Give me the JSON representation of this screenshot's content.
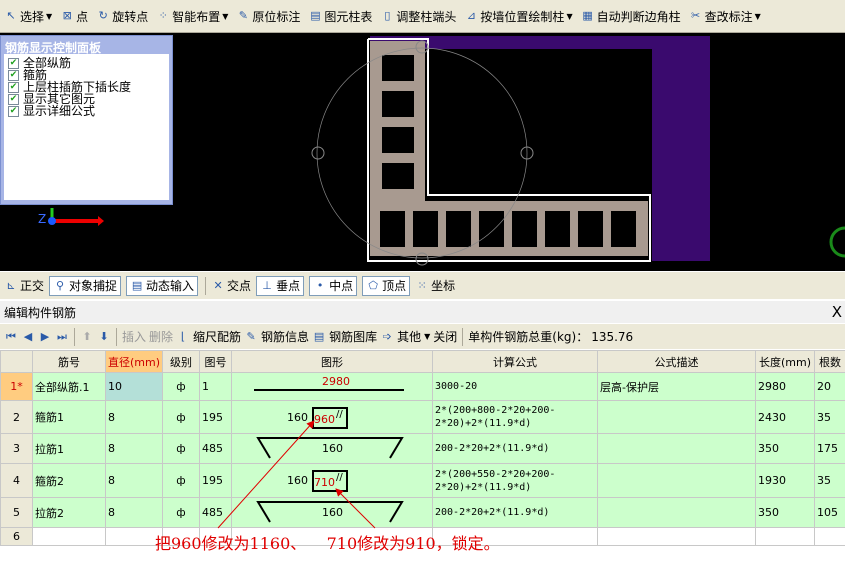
{
  "toolbar": {
    "items": [
      {
        "icon": "cursor-icon",
        "label": "选择",
        "dropdown": true
      },
      {
        "icon": "point-icon",
        "label": "点"
      },
      {
        "icon": "rotate-point-icon",
        "label": "旋转点"
      },
      {
        "icon": "smart-layout-icon",
        "label": "智能布置",
        "dropdown": true
      },
      {
        "icon": "annotate-icon",
        "label": "原位标注"
      },
      {
        "icon": "column-table-icon",
        "label": "图元柱表"
      },
      {
        "icon": "adjust-end-icon",
        "label": "调整柱端头"
      },
      {
        "icon": "wall-column-icon",
        "label": "按墙位置绘制柱",
        "dropdown": true
      },
      {
        "icon": "corner-column-icon",
        "label": "自动判断边角柱"
      },
      {
        "icon": "check-annotation-icon",
        "label": "查改标注",
        "dropdown": true
      }
    ]
  },
  "panel": {
    "title": "钢筋显示控制面板",
    "options": [
      {
        "label": "全部纵筋",
        "checked": true
      },
      {
        "label": "箍筋",
        "checked": true
      },
      {
        "label": "上层柱插筋下插长度",
        "checked": true
      },
      {
        "label": "显示其它图元",
        "checked": true
      },
      {
        "label": "显示详细公式",
        "checked": true
      }
    ],
    "axis_label": "Z"
  },
  "snap_toolbar": {
    "items": [
      "正交",
      "对象捕捉",
      "动态输入",
      "交点",
      "垂点",
      "中点",
      "顶点",
      "坐标"
    ]
  },
  "editor": {
    "title": "编辑构件钢筋",
    "close": "X",
    "toolbar": {
      "insert": "插入",
      "delete": "删除",
      "scale": "缩尺配筋",
      "info": "钢筋信息",
      "library": "钢筋图库",
      "other": "其他",
      "close": "关闭",
      "weight_label": "单构件钢筋总重(kg)：",
      "weight": "135.76"
    },
    "columns": [
      "",
      "筋号",
      "直径(mm)",
      "级别",
      "图号",
      "图形",
      "计算公式",
      "公式描述",
      "长度(mm)",
      "根数"
    ],
    "rows": [
      {
        "num": "1*",
        "name": "全部纵筋.1",
        "dia": "10",
        "grade": "ф",
        "fig": "1",
        "shape_label": "2980",
        "formula": "3000-20",
        "desc": "层高-保护层",
        "length": "2980",
        "count": "20"
      },
      {
        "num": "2",
        "name": "箍筋1",
        "dia": "8",
        "grade": "ф",
        "fig": "195",
        "shape_left": "160",
        "shape_label": "960",
        "formula": "2*(200+800-2*20+200-2*20)+2*(11.9*d)",
        "desc": "",
        "length": "2430",
        "count": "35"
      },
      {
        "num": "3",
        "name": "拉筋1",
        "dia": "8",
        "grade": "ф",
        "fig": "485",
        "shape_label": "160",
        "formula": "200-2*20+2*(11.9*d)",
        "desc": "",
        "length": "350",
        "count": "175"
      },
      {
        "num": "4",
        "name": "箍筋2",
        "dia": "8",
        "grade": "ф",
        "fig": "195",
        "shape_left": "160",
        "shape_label": "710",
        "formula": "2*(200+550-2*20+200-2*20)+2*(11.9*d)",
        "desc": "",
        "length": "1930",
        "count": "35"
      },
      {
        "num": "5",
        "name": "拉筋2",
        "dia": "8",
        "grade": "ф",
        "fig": "485",
        "shape_label": "160",
        "formula": "200-2*20+2*(11.9*d)",
        "desc": "",
        "length": "350",
        "count": "105"
      },
      {
        "num": "6",
        "name": "",
        "dia": "",
        "grade": "",
        "fig": "",
        "shape_label": "",
        "formula": "",
        "desc": "",
        "length": "",
        "count": ""
      }
    ]
  },
  "annotation": "把960修改为1160、    710修改为910，锁定。",
  "colors": {
    "annotation": "#e00000",
    "row_bg": "#ccffcc",
    "selected_header": "#ffcc80",
    "wall": "#3a0a6e",
    "column": "#a89a90"
  }
}
